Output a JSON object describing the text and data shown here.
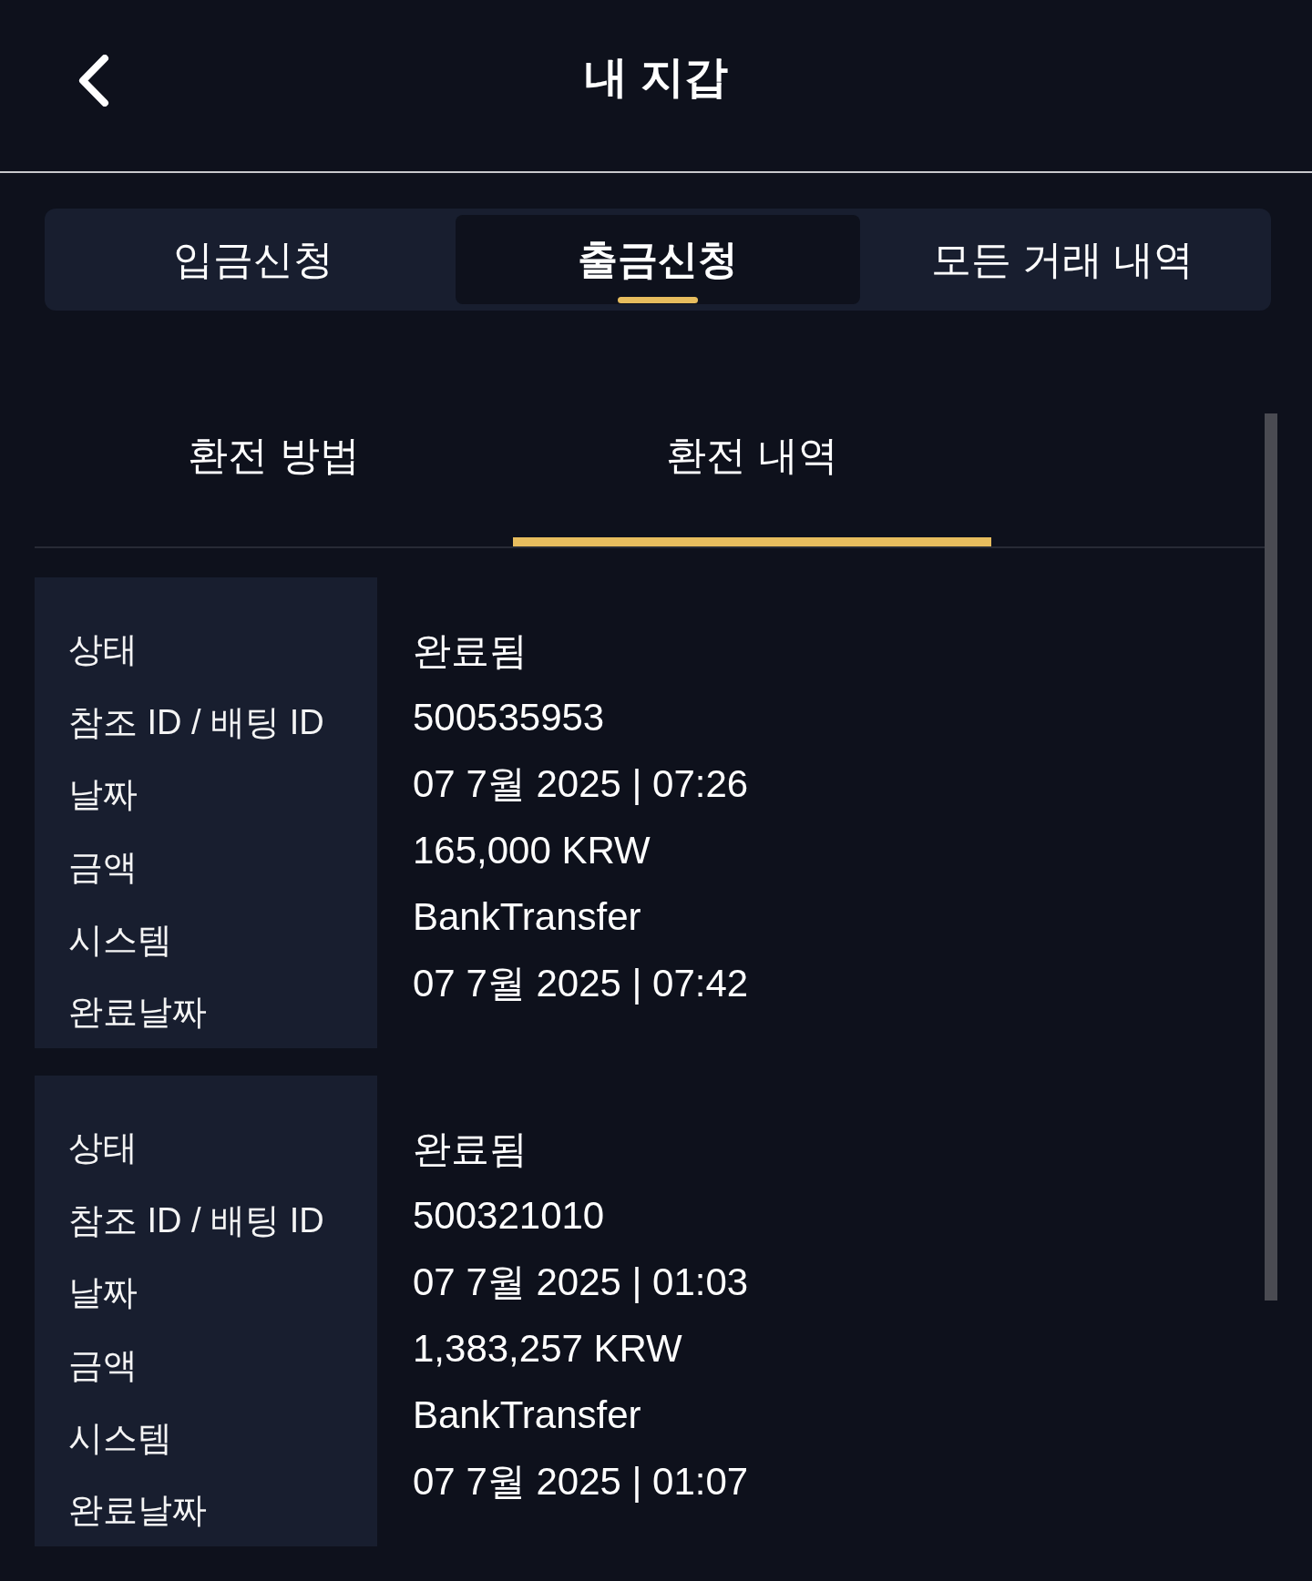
{
  "header": {
    "title": "내 지갑"
  },
  "tabs": [
    {
      "label": "입금신청",
      "selected": false
    },
    {
      "label": "출금신청",
      "selected": true
    },
    {
      "label": "모든 거래 내역",
      "selected": false
    }
  ],
  "sub_tabs": [
    {
      "label": "환전 방법",
      "selected": false
    },
    {
      "label": "환전 내역",
      "selected": true
    }
  ],
  "records": [
    {
      "fields": [
        {
          "label": "상태",
          "value": "완료됨"
        },
        {
          "label": "참조 ID / 배팅 ID",
          "value": "500535953"
        },
        {
          "label": "날짜",
          "value": "07 7월 2025 | 07:26"
        },
        {
          "label": "금액",
          "value": "165,000 KRW"
        },
        {
          "label": "시스템",
          "value": "BankTransfer"
        },
        {
          "label": "완료날짜",
          "value": "07 7월 2025 | 07:42"
        }
      ]
    },
    {
      "fields": [
        {
          "label": "상태",
          "value": "완료됨"
        },
        {
          "label": "참조 ID / 배팅 ID",
          "value": "500321010"
        },
        {
          "label": "날짜",
          "value": "07 7월 2025 | 01:03"
        },
        {
          "label": "금액",
          "value": "1,383,257 KRW"
        },
        {
          "label": "시스템",
          "value": "BankTransfer"
        },
        {
          "label": "완료날짜",
          "value": "07 7월 2025 | 01:07"
        }
      ]
    }
  ]
}
